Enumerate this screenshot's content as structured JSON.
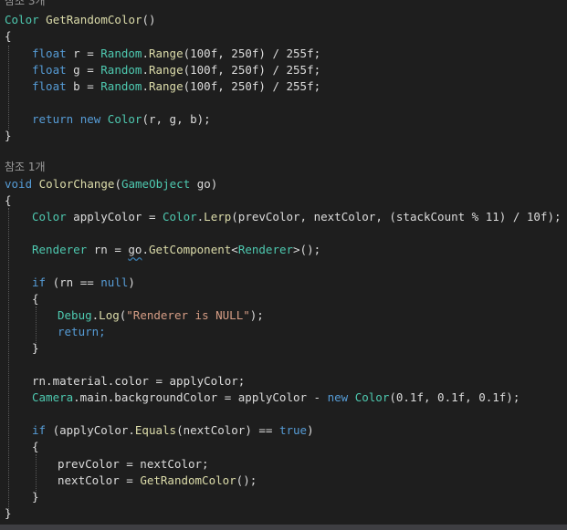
{
  "refs": {
    "ref_3": "참조 3개",
    "ref_1": "참조 1개"
  },
  "tok": {
    "color": "Color",
    "GetRandomColor": "GetRandomColor",
    "parens": "()",
    "lbrace": "{",
    "rbrace": "}",
    "float": "float",
    "r_assign": " r = ",
    "g_assign": " g = ",
    "b_assign": " b = ",
    "Random": "Random",
    "dot": ".",
    "Range": "Range",
    "range_args": "(100f, 250f) / 255f;",
    "return": "return",
    "new": "new",
    "rgb_args": "(r, g, b);",
    "void": "void",
    "ColorChange": "ColorChange",
    "lparen": "(",
    "GameObject": "GameObject",
    "go_param": " go)",
    "applyColor_assign": " applyColor = ",
    "Lerp": "Lerp",
    "lerp_args": "(prevColor, nextColor, (stackCount % 11) / 10f);",
    "Renderer": "Renderer",
    "rn_assign": " rn = ",
    "go": "go",
    "GetComponent": "GetComponent",
    "lt": "<",
    "gt_call": ">();",
    "if": "if",
    "rn_eq": " (rn == ",
    "null": "null",
    "rparen": ")",
    "Debug": "Debug",
    "Log": "Log",
    "log_string": "\"Renderer is NULL\"",
    "rparen_semi": ");",
    "return_semi": "return;",
    "material_line": "rn.material.color = applyColor;",
    "Camera": "Camera",
    "camera_rest": ".main.backgroundColor = applyColor - ",
    "new_color_args": "(0.1f, 0.1f, 0.1f);",
    "if_open": " (applyColor.",
    "Equals": "Equals",
    "equals_args": "(nextColor) == ",
    "true": "true",
    "prev_assign": "prevColor = nextColor;",
    "next_assign": "nextColor = ",
    "semi_call": "();"
  }
}
